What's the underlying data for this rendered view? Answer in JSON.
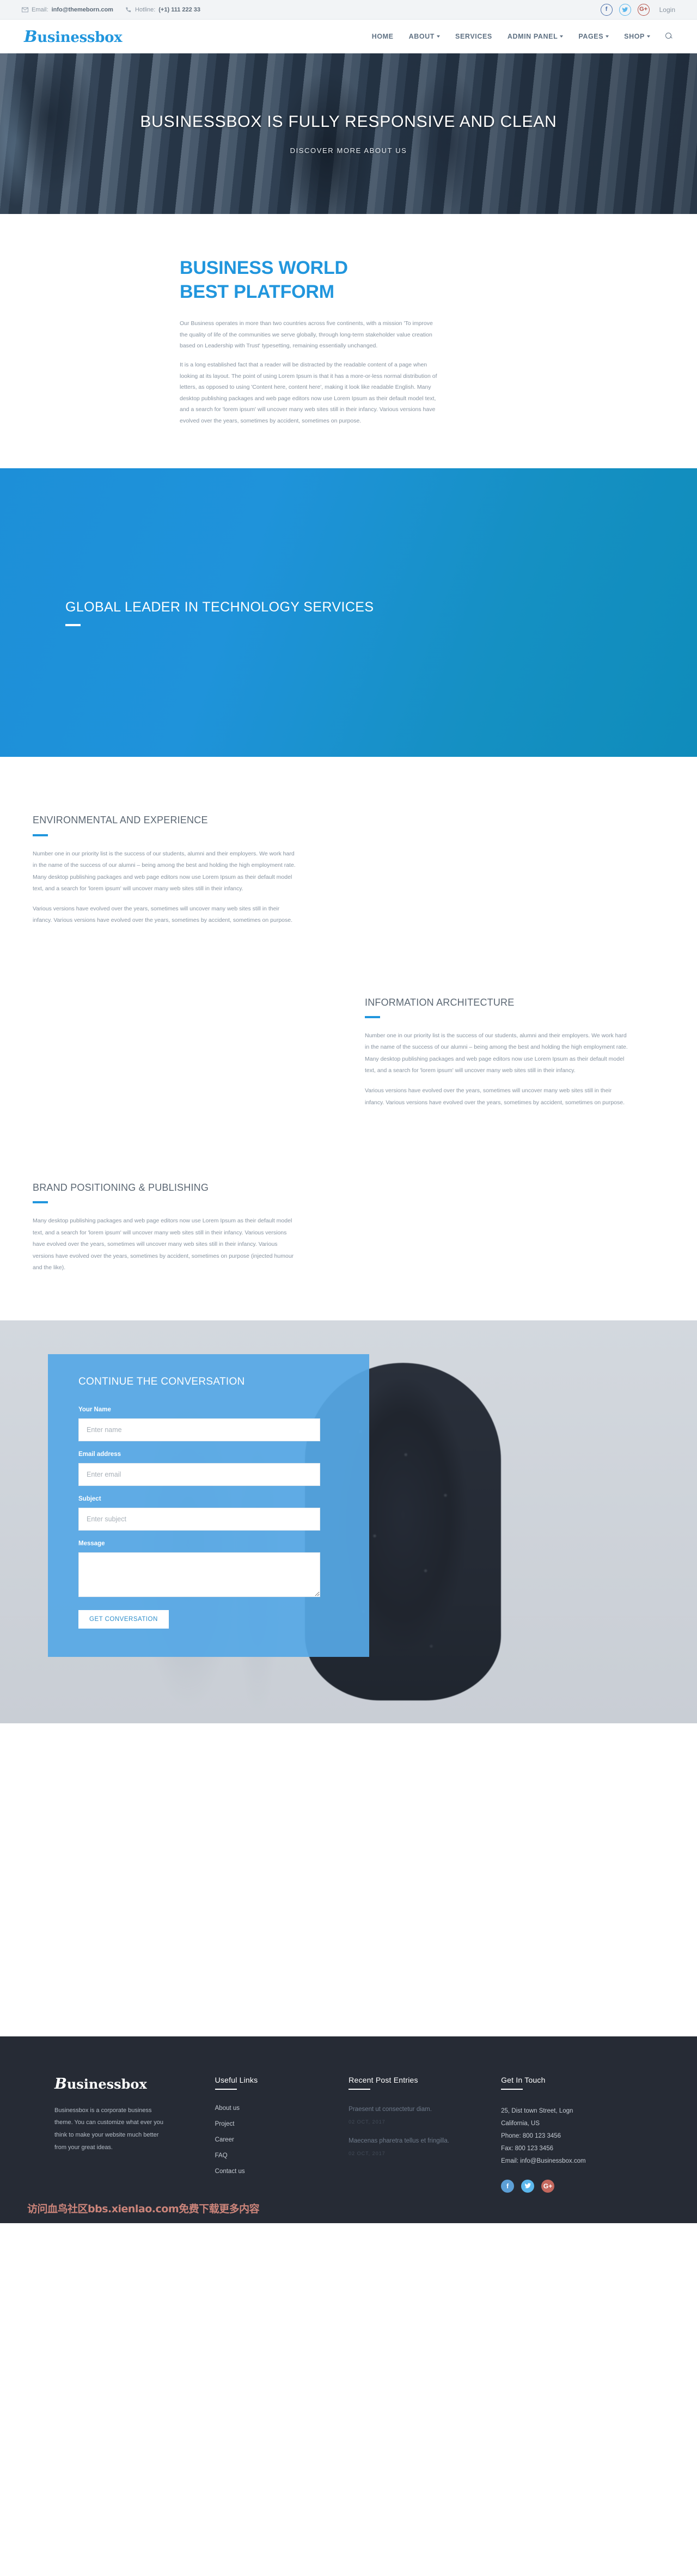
{
  "topbar": {
    "email_label": "Email:",
    "email_value": "info@themeborn.com",
    "hotline_label": "Hotline:",
    "hotline_value": "(+1) 111 222 33",
    "socials": [
      {
        "name": "facebook",
        "glyph": "f"
      },
      {
        "name": "twitter",
        "glyph": "❈"
      },
      {
        "name": "google-plus",
        "glyph": "G+"
      }
    ],
    "login_label": "Login"
  },
  "nav": {
    "brand_cap": "B",
    "brand_rest": "usinessbox",
    "items": [
      {
        "label": "HOME",
        "caret": false
      },
      {
        "label": "ABOUT",
        "caret": true
      },
      {
        "label": "SERVICES",
        "caret": false
      },
      {
        "label": "ADMIN PANEL",
        "caret": true
      },
      {
        "label": "PAGES",
        "caret": true
      },
      {
        "label": "SHOP",
        "caret": true
      }
    ],
    "search_icon": "search-icon"
  },
  "hero": {
    "title": "BUSINESSBOX IS FULLY RESPONSIVE AND CLEAN",
    "subtitle": "DISCOVER MORE ABOUT US"
  },
  "intro": {
    "title": "BUSINESS WORLD BEST PLATFORM",
    "paragraphs": [
      "Our Business operates in more than two countries across five continents, with a mission 'To improve the quality of life of the communities we serve globally, through long-term stakeholder value creation based on Leadership with Trust' typesetting, remaining essentially unchanged.",
      "It is a long established fact that a reader will be distracted by the readable content of a page when looking at its layout. The point of using Lorem Ipsum is that it has a more-or-less normal distribution of letters, as opposed to using 'Content here, content here', making it look like readable English. Many desktop publishing packages and web page editors now use Lorem Ipsum as their default model text, and a search for 'lorem ipsum' will uncover many web sites still in their infancy. Various versions have evolved over the years, sometimes by accident, sometimes on purpose."
    ]
  },
  "banner": {
    "title": "GLOBAL LEADER IN TECHNOLOGY SERVICES"
  },
  "features": [
    {
      "title": "ENVIRONMENTAL AND EXPERIENCE",
      "paragraphs": [
        "Number one in our priority list is the success of our students, alumni and their employers. We work hard in the name of the success of our alumni – being among the best and holding the high employment rate. Many desktop publishing packages and web page editors now use Lorem Ipsum as their default model text, and a search for 'lorem ipsum' will uncover many web sites still in their infancy.",
        "Various versions have evolved over the years, sometimes will uncover many web sites still in their infancy. Various versions have evolved over the years, sometimes by accident, sometimes on purpose."
      ]
    },
    {
      "title": "INFORMATION ARCHITECTURE",
      "paragraphs": [
        "Number one in our priority list is the success of our students, alumni and their employers. We work hard in the name of the success of our alumni – being among the best and holding the high employment rate. Many desktop publishing packages and web page editors now use Lorem Ipsum as their default model text, and a search for 'lorem ipsum' will uncover many web sites still in their infancy.",
        "Various versions have evolved over the years, sometimes will uncover many web sites still in their infancy. Various versions have evolved over the years, sometimes by accident, sometimes on purpose."
      ]
    },
    {
      "title": "BRAND POSITIONING & PUBLISHING",
      "paragraphs": [
        "Many desktop publishing packages and web page editors now use Lorem Ipsum as their default model text, and a search for 'lorem ipsum' will uncover many web sites still in their infancy. Various versions have evolved over the years, sometimes will uncover many web sites still in their infancy. Various versions have evolved over the years, sometimes by accident, sometimes on purpose (injected humour and the like)."
      ]
    }
  ],
  "contact_form": {
    "title": "CONTINUE THE CONVERSATION",
    "name_label": "Your Name",
    "name_placeholder": "Enter name",
    "name_value": "",
    "email_label": "Email address",
    "email_placeholder": "Enter email",
    "email_value": "",
    "subject_label": "Subject",
    "subject_placeholder": "Enter subject",
    "subject_value": "",
    "message_label": "Message",
    "message_placeholder": "",
    "message_value": "",
    "submit_label": "GET CONVERSATION"
  },
  "footer": {
    "brand_cap": "B",
    "brand_rest": "usinessbox",
    "description": "Businessbox is a corporate business theme. You can customize what ever you think to make your website much better from your great ideas.",
    "useful_links_head": "Useful Links",
    "useful_links": [
      "About us",
      "Project",
      "Career",
      "FAQ",
      "Contact us"
    ],
    "recent_head": "Recent Post Entries",
    "recent_posts": [
      {
        "title": "Praesent ut consectetur diam.",
        "date": "02 OCT, 2017"
      },
      {
        "title": "Maecenas pharetra tellus et fringilla.",
        "date": "02 OCT, 2017"
      }
    ],
    "touch_head": "Get In Touch",
    "address_line1": "25, Dist town Street, Logn",
    "address_line2": "California, US",
    "phone": "Phone: 800 123 3456",
    "fax": "Fax: 800 123 3456",
    "email": "Email: info@Businessbox.com",
    "socials": [
      {
        "name": "facebook",
        "glyph": "f"
      },
      {
        "name": "twitter",
        "glyph": "❈"
      },
      {
        "name": "google-plus",
        "glyph": "G+"
      }
    ]
  },
  "watermark": "访问血鸟社区bbs.xienlao.com免费下载更多内容",
  "colors": {
    "accent": "#2196dd",
    "banner_from": "#1d8fd8",
    "banner_to": "#0f8cbb",
    "form_blue": "#56a8e5",
    "footer_bg": "#262b35",
    "text_body": "#8894a1"
  }
}
